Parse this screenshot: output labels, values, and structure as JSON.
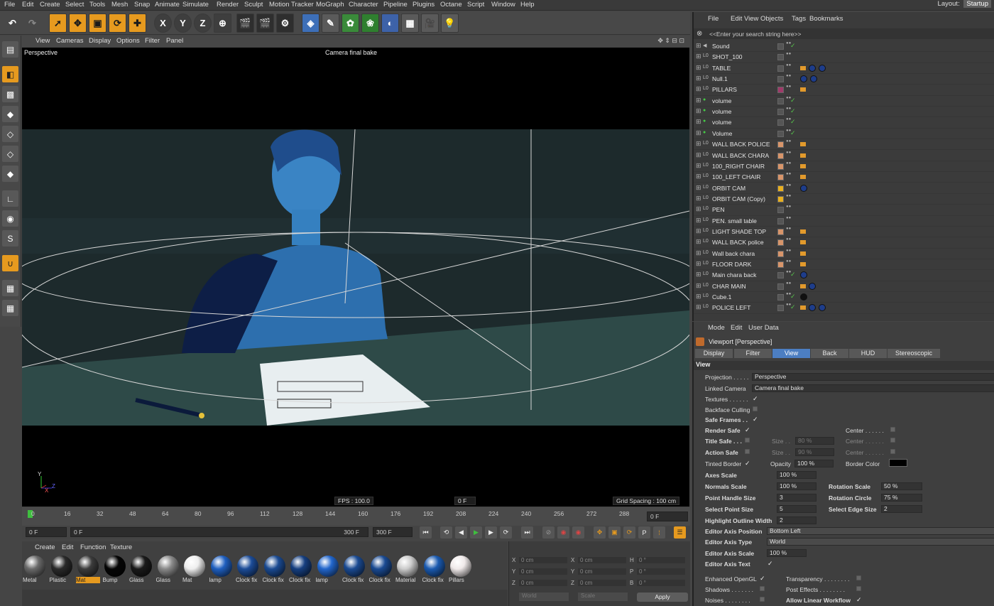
{
  "menubar": {
    "items": [
      "File",
      "Edit",
      "Create",
      "Select",
      "Tools",
      "Mesh",
      "Snap",
      "Animate",
      "Simulate",
      "Render",
      "Sculpt",
      "Motion Tracker",
      "MoGraph",
      "Character",
      "Pipeline",
      "Plugins",
      "Octane",
      "Script",
      "Window",
      "Help"
    ],
    "layout_label": "Layout:",
    "layout_value": "Startup"
  },
  "toolbar": {
    "x_label": "X",
    "y_label": "Y",
    "z_label": "Z"
  },
  "viewport_menu": [
    "View",
    "Cameras",
    "Display",
    "Options",
    "Filter",
    "Panel"
  ],
  "viewport": {
    "name": "Perspective",
    "camera": "Camera final bake",
    "fps": "FPS : 100.0",
    "frame": "0 F",
    "grid": "Grid Spacing : 100 cm"
  },
  "timeline": {
    "ticks": [
      "0",
      "16",
      "32",
      "48",
      "64",
      "80",
      "96",
      "112",
      "128",
      "144",
      "160",
      "176",
      "192",
      "208",
      "224",
      "240",
      "256",
      "272",
      "288"
    ],
    "current": "0 F"
  },
  "playback": {
    "start": "0 F",
    "range_start": "0 F",
    "range_end": "300 F",
    "end": "300 F"
  },
  "material_menu": [
    "Create",
    "Edit",
    "Function",
    "Texture"
  ],
  "materials": [
    {
      "label": "Metal",
      "color": "#6a6a6a"
    },
    {
      "label": "Plastic",
      "color": "#2a2a2a"
    },
    {
      "label": "Mat",
      "color": "#3c3c3c"
    },
    {
      "label": "Bump",
      "color": "#050505"
    },
    {
      "label": "Glass",
      "color": "#1a1a1a"
    },
    {
      "label": "Glass",
      "color": "#8a8a8a"
    },
    {
      "label": "Mat",
      "color": "#eeeeee"
    },
    {
      "label": "lamp",
      "color": "#1f5fbf"
    },
    {
      "label": "Clock fix",
      "color": "#1c4c98"
    },
    {
      "label": "Clock fix",
      "color": "#1a4a92"
    },
    {
      "label": "Clock fix",
      "color": "#163f80"
    },
    {
      "label": "lamp",
      "color": "#2266cc"
    },
    {
      "label": "Clock fix",
      "color": "#1a4a92"
    },
    {
      "label": "Clock fix",
      "color": "#1a4a92"
    },
    {
      "label": "Material",
      "color": "#cccccc"
    },
    {
      "label": "Clock fix",
      "color": "#1a5ab0"
    },
    {
      "label": "Pillars",
      "color": "#f0eaea"
    }
  ],
  "coords": {
    "x_pos": "0 cm",
    "y_pos": "0 cm",
    "z_pos": "0 cm",
    "x_size": "0 cm",
    "y_size": "0 cm",
    "z_size": "0 cm",
    "h": "0 °",
    "p": "0 °",
    "b": "0 °",
    "mode1": "World",
    "mode2": "Scale",
    "apply": "Apply"
  },
  "objects_menu": [
    "File",
    "Edit",
    "View",
    "Objects",
    "Tags",
    "Bookmarks"
  ],
  "search_placeholder": "<<Enter your search string here>>",
  "objects": [
    "Sound",
    "SHOT_100",
    "TABLE",
    "Null.1",
    "PILLARS",
    "volume",
    "volume",
    "volume",
    "Volume",
    "WALL BACK POLICE",
    "WALL BACK CHARA",
    "100_RIGHT CHAIR",
    "100_LEFT CHAIR",
    "ORBIT CAM",
    "ORBIT CAM (Copy)",
    "PEN",
    "PEN. small table",
    "LIGHT SHADE TOP",
    "WALL BACK police",
    "Wall back chara",
    "FLOOR DARK",
    "Main chara back",
    "CHAR MAIN",
    "Cube.1",
    "POLICE LEFT"
  ],
  "attr_menu": [
    "Mode",
    "Edit",
    "User Data"
  ],
  "attr_title": "Viewport [Perspective]",
  "attr_tabs": [
    "Display",
    "Filter",
    "View",
    "Back",
    "HUD",
    "Stereoscopic"
  ],
  "attr_section": "View",
  "attrs": {
    "projection_label": "Projection . . . . .",
    "projection": "Perspective",
    "linked_label": "Linked Camera",
    "linked": "Camera final bake",
    "textures": "Textures . . . . . .",
    "backface": "Backface Culling",
    "safe_frames": "Safe Frames . .",
    "render_safe": "Render Safe",
    "title_safe": "Title Safe . . .",
    "action_safe": "Action Safe",
    "tinted": "Tinted Border",
    "size_label": "Size . .",
    "size1": "80 %",
    "size2": "90 %",
    "center_label": "Center . . . . . .",
    "opacity_label": "Opacity",
    "opacity": "100 %",
    "border_color": "Border Color",
    "axes_scale": "Axes Scale",
    "axes_scale_v": "100 %",
    "normals_scale": "Normals Scale",
    "normals_scale_v": "100 %",
    "rotation_scale": "Rotation Scale",
    "rotation_scale_v": "50 %",
    "point_handle": "Point Handle Size",
    "point_handle_v": "3",
    "rotation_circle": "Rotation Circle",
    "rotation_circle_v": "75 %",
    "select_point": "Select Point Size",
    "select_point_v": "5",
    "select_edge": "Select Edge Size",
    "select_edge_v": "2",
    "highlight": "Highlight Outline Width",
    "highlight_v": "2",
    "editor_pos": "Editor Axis Position",
    "editor_pos_v": "Bottom Left",
    "editor_type": "Editor Axis Type",
    "editor_type_v": "World",
    "editor_scale": "Editor Axis Scale",
    "editor_scale_v": "100 %",
    "editor_text": "Editor Axis Text",
    "enh_opengl": "Enhanced OpenGL",
    "transparency": "Transparency . . . . . . . .",
    "shadows": "Shadows . . . . . . .",
    "post_effects": "Post Effects . . . . . . . .",
    "noises": "Noises . . . . . . . .",
    "linear_workflow": "Allow Linear Workflow"
  }
}
